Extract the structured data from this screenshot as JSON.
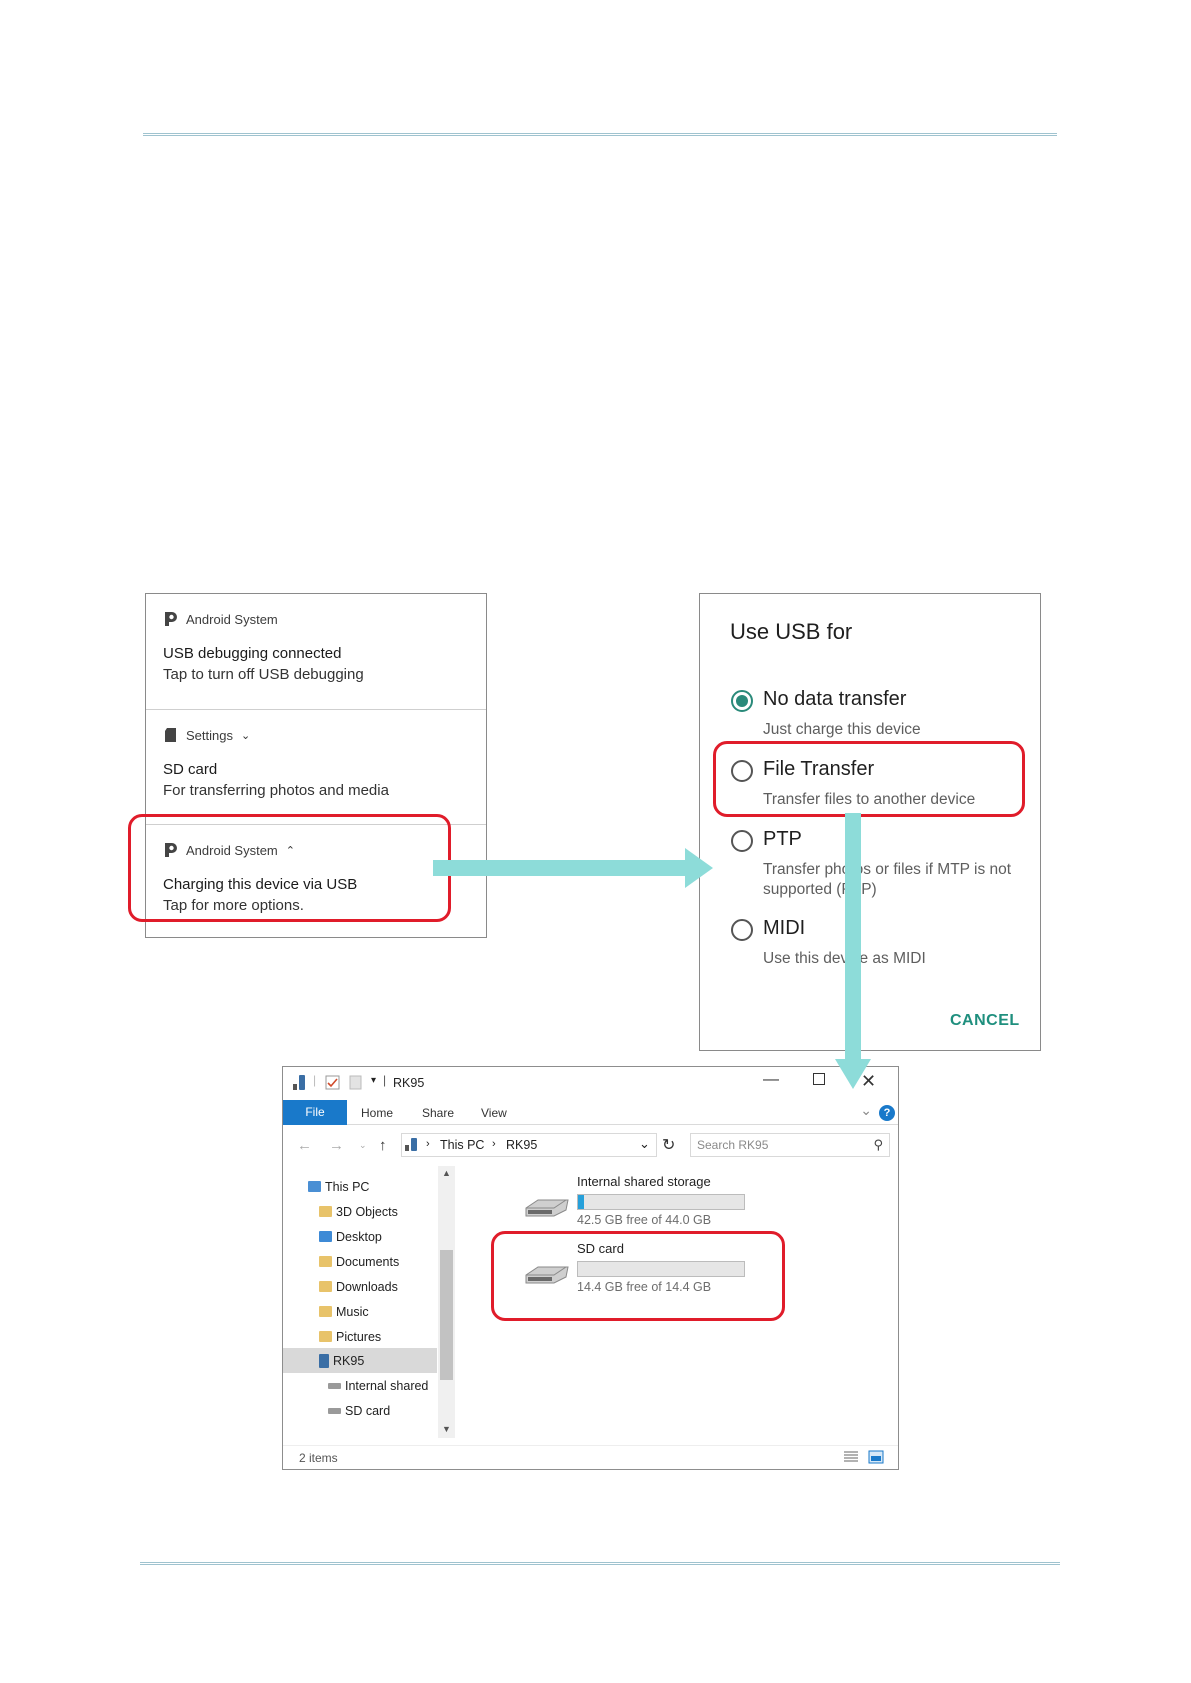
{
  "notifications": [
    {
      "app": "Android System",
      "expander": "",
      "title": "USB debugging connected",
      "text": "Tap to turn off USB debugging"
    },
    {
      "app": "Settings",
      "expander": "⌄",
      "title": "SD card",
      "text": "For transferring photos and media"
    },
    {
      "app": "Android System",
      "expander": "⌃",
      "title": "Charging this device via USB",
      "text": "Tap for more options."
    }
  ],
  "usb_dialog": {
    "title": "Use USB for",
    "options": [
      {
        "label": "No data transfer",
        "desc": "Just charge this device",
        "checked": true
      },
      {
        "label": "File Transfer",
        "desc": "Transfer files to another device",
        "checked": false
      },
      {
        "label": "PTP",
        "desc": "Transfer photos or files if MTP is not supported (PTP)",
        "checked": false
      },
      {
        "label": "MIDI",
        "desc": "Use this device as MIDI",
        "checked": false
      }
    ],
    "cancel": "CANCEL"
  },
  "explorer": {
    "window_title": "RK95",
    "tabs": {
      "file": "File",
      "home": "Home",
      "share": "Share",
      "view": "View"
    },
    "address": {
      "root": "This PC",
      "current": "RK95"
    },
    "search_placeholder": "Search RK95",
    "nav_items": [
      {
        "label": "This PC"
      },
      {
        "label": "3D Objects"
      },
      {
        "label": "Desktop"
      },
      {
        "label": "Documents"
      },
      {
        "label": "Downloads"
      },
      {
        "label": "Music"
      },
      {
        "label": "Pictures"
      },
      {
        "label": "RK95"
      },
      {
        "label": "Internal shared"
      },
      {
        "label": "SD card"
      }
    ],
    "drives": [
      {
        "name": "Internal shared storage",
        "free": "42.5 GB free of 44.0 GB",
        "used_fraction": 0.034
      },
      {
        "name": "SD card",
        "free": "14.4 GB free of 14.4 GB",
        "used_fraction": 0.0
      }
    ],
    "status": "2 items"
  },
  "colors": {
    "highlight": "#e01c2a",
    "arrow": "#8ddcd9",
    "accent_teal": "#1f8f7e",
    "explorer_blue": "#1979ca"
  }
}
